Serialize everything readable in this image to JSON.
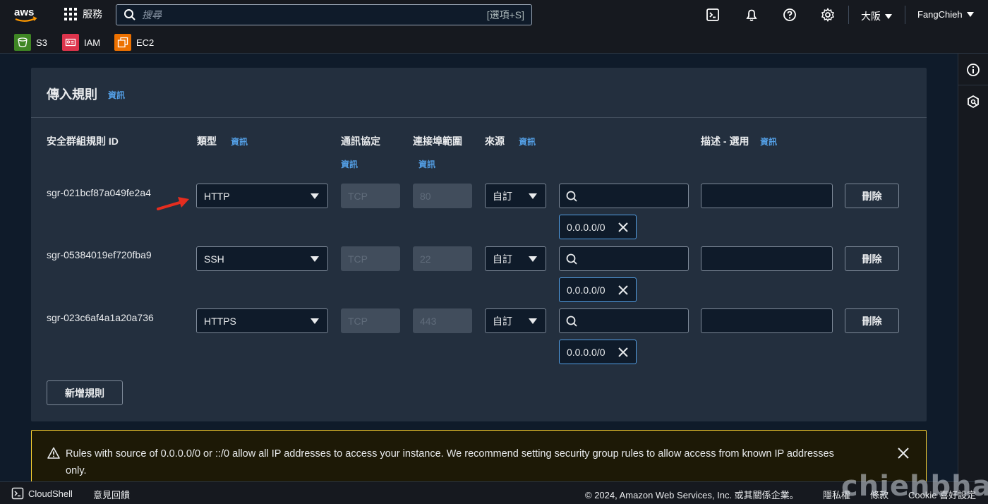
{
  "topnav": {
    "logo": "aws",
    "services_label": "服務",
    "search_placeholder": "搜尋",
    "search_shortcut": "[選項+S]",
    "region": "大阪",
    "user": "FangChieh"
  },
  "favorites": [
    {
      "label": "S3",
      "color": "#3f8624"
    },
    {
      "label": "IAM",
      "color": "#dd344c"
    },
    {
      "label": "EC2",
      "color": "#ed7100"
    }
  ],
  "panel": {
    "title": "傳入規則",
    "info": "資訊",
    "columns": {
      "rule_id": "安全群組規則 ID",
      "type": "類型",
      "protocol": "通訊協定",
      "port_range": "連接埠範圍",
      "source": "來源",
      "description": "描述 - 選用"
    },
    "rules": [
      {
        "id": "sgr-021bcf87a049fe2a4",
        "type": "HTTP",
        "protocol": "TCP",
        "port": "80",
        "source_mode": "自訂",
        "cidr": "0.0.0.0/0",
        "delete": "刪除"
      },
      {
        "id": "sgr-05384019ef720fba9",
        "type": "SSH",
        "protocol": "TCP",
        "port": "22",
        "source_mode": "自訂",
        "cidr": "0.0.0.0/0",
        "delete": "刪除"
      },
      {
        "id": "sgr-023c6af4a1a20a736",
        "type": "HTTPS",
        "protocol": "TCP",
        "port": "443",
        "source_mode": "自訂",
        "cidr": "0.0.0.0/0",
        "delete": "刪除"
      }
    ],
    "add_rule": "新增規則"
  },
  "warning": {
    "text": "Rules with source of 0.0.0.0/0 or ::/0 allow all IP addresses to access your instance. We recommend setting security group rules to allow access from known IP addresses only."
  },
  "footer": {
    "cloudshell": "CloudShell",
    "feedback": "意見回饋",
    "copyright": "© 2024, Amazon Web Services, Inc. 或其關係企業。",
    "privacy": "隱私權",
    "terms": "條款",
    "cookie": "Cookie 喜好設定"
  },
  "watermark": "chiehbhaa",
  "colors": {
    "nav_bg": "#16191f",
    "panel_bg": "#232f3e",
    "link": "#539fe5",
    "warning_border": "#fbd332",
    "arrow": "#e52d1f"
  }
}
